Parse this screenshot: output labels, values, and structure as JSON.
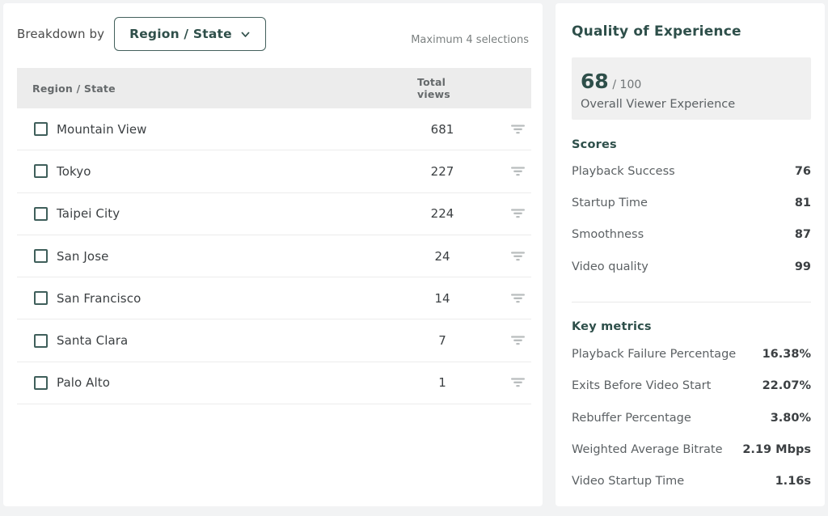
{
  "breakdown": {
    "label": "Breakdown by",
    "selected": "Region / State",
    "chevron_icon": "chevron-down-icon",
    "max_selections_note": "Maximum 4 selections"
  },
  "table": {
    "columns": {
      "region": "Region / State",
      "total_views_line1": "Total",
      "total_views_line2": "views"
    },
    "filter_icon": "filter-icon",
    "rows": [
      {
        "name": "Mountain View",
        "views": "681",
        "checked": false
      },
      {
        "name": "Tokyo",
        "views": "227",
        "checked": false
      },
      {
        "name": "Taipei City",
        "views": "224",
        "checked": false
      },
      {
        "name": "San Jose",
        "views": "24",
        "checked": false
      },
      {
        "name": "San Francisco",
        "views": "14",
        "checked": false
      },
      {
        "name": "Santa Clara",
        "views": "7",
        "checked": false
      },
      {
        "name": "Palo Alto",
        "views": "1",
        "checked": false
      }
    ]
  },
  "qoe": {
    "title": "Quality of Experience",
    "overall": {
      "value": "68",
      "max": "/ 100",
      "caption": "Overall Viewer Experience"
    },
    "scores_title": "Scores",
    "scores": [
      {
        "label": "Playback Success",
        "value": "76"
      },
      {
        "label": "Startup Time",
        "value": "81"
      },
      {
        "label": "Smoothness",
        "value": "87"
      },
      {
        "label": "Video quality",
        "value": "99"
      }
    ],
    "key_metrics_title": "Key metrics",
    "key_metrics": [
      {
        "label": "Playback Failure Percentage",
        "value": "16.38%"
      },
      {
        "label": "Exits Before Video Start",
        "value": "22.07%"
      },
      {
        "label": "Rebuffer Percentage",
        "value": "3.80%"
      },
      {
        "label": "Weighted Average Bitrate",
        "value": "2.19 Mbps"
      },
      {
        "label": "Video Startup Time",
        "value": "1.16s"
      }
    ]
  },
  "colors": {
    "page_background": "#f2f3f4",
    "card_background": "#ffffff",
    "accent_teal": "#2e4f4a",
    "header_band": "#ececec",
    "score_box": "#f0f0f0",
    "muted_text": "#5c6164"
  }
}
